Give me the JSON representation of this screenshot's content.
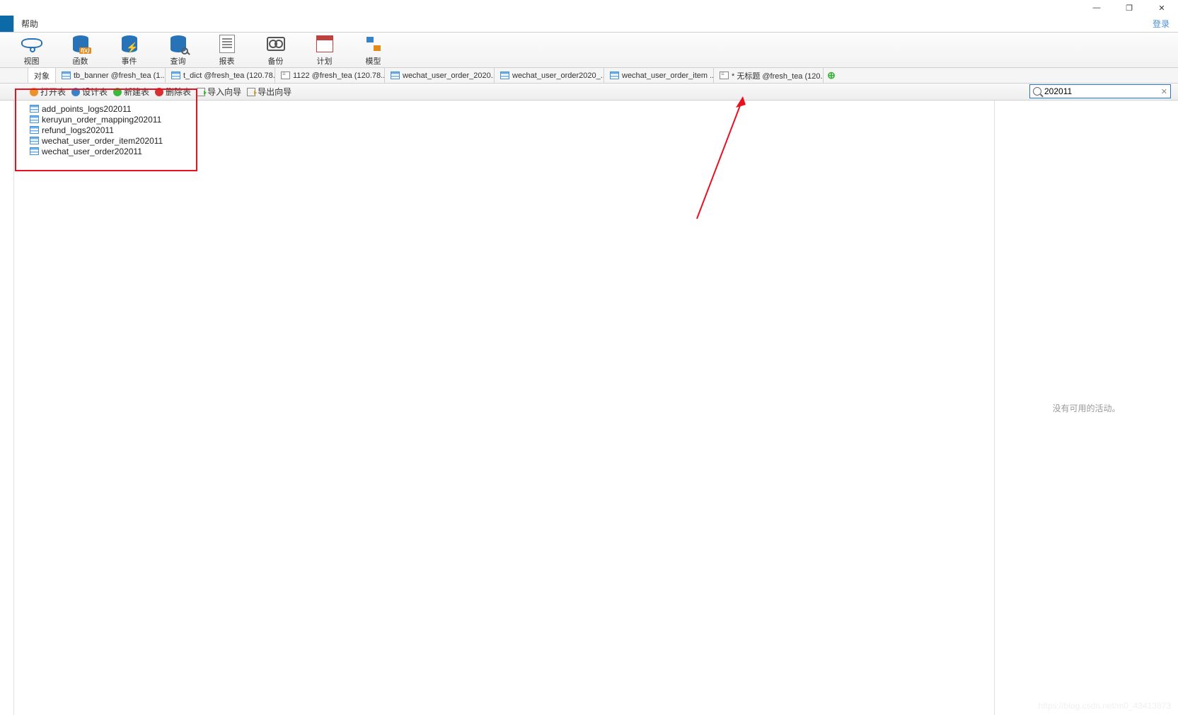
{
  "window": {
    "minimize": "—",
    "maximize": "❐",
    "close": "✕"
  },
  "menu": {
    "help": "帮助",
    "login": "登录"
  },
  "toolbar": {
    "view": "视图",
    "function": "函数",
    "event": "事件",
    "query": "查询",
    "report": "报表",
    "backup": "备份",
    "schedule": "计划",
    "model": "模型",
    "fx_badge": "f(x)"
  },
  "tabs": [
    {
      "label": "对象",
      "type": "active"
    },
    {
      "label": "tb_banner @fresh_tea (1...",
      "type": "table"
    },
    {
      "label": "t_dict @fresh_tea (120.78...",
      "type": "table"
    },
    {
      "label": "1122 @fresh_tea (120.78...",
      "type": "query"
    },
    {
      "label": "wechat_user_order_2020...",
      "type": "table"
    },
    {
      "label": "wechat_user_order2020_...",
      "type": "table"
    },
    {
      "label": "wechat_user_order_item ...",
      "type": "table"
    },
    {
      "label": "* 无标题 @fresh_tea (120...",
      "type": "query"
    }
  ],
  "subtoolbar": {
    "open": "打开表",
    "design": "设计表",
    "new": "新建表",
    "delete": "删除表",
    "import": "导入向导",
    "export": "导出向导"
  },
  "search": {
    "value": "202011"
  },
  "objects": [
    "add_points_logs202011",
    "keruyun_order_mapping202011",
    "refund_logs202011",
    "wechat_user_order_item202011",
    "wechat_user_order202011"
  ],
  "right_panel": {
    "empty": "没有可用的活动。"
  },
  "watermark": "https://blog.csdn.net/m0_43413873"
}
